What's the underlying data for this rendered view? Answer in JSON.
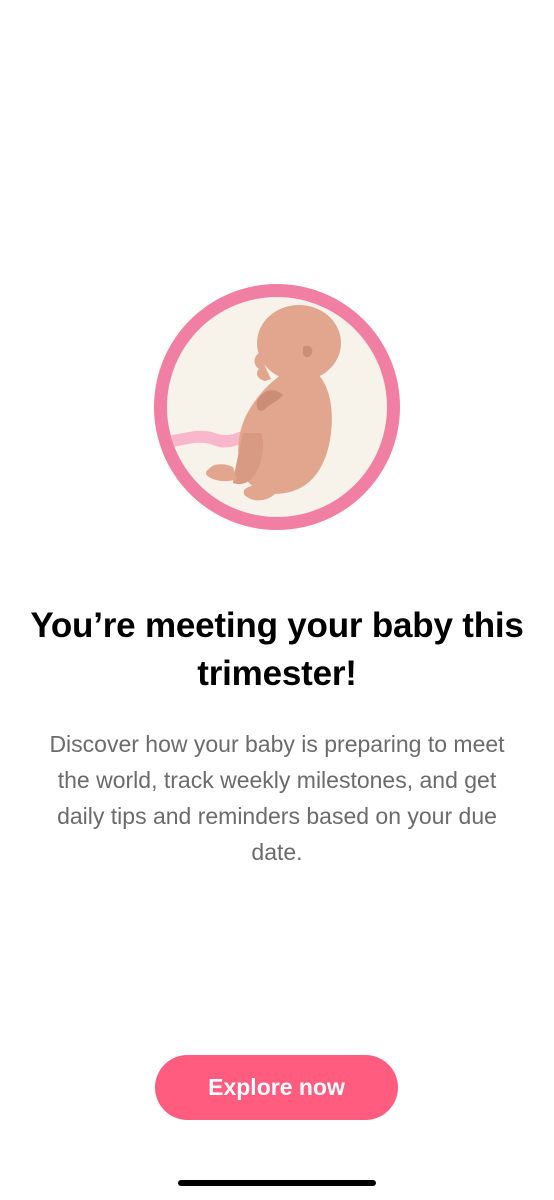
{
  "illustration": {
    "icon": "fetus-in-womb-illustration",
    "colors": {
      "ring": "#f07fa3",
      "inner": "#f7f3ea",
      "skin": "#e2a68e",
      "skin_shadow": "#cc8d76",
      "cord": "#f9b7cc"
    }
  },
  "content": {
    "headline": "You’re meeting your baby this trimester!",
    "description": "Discover how your baby is preparing to meet the world, track weekly milestones, and get daily tips and reminders based on your due date."
  },
  "actions": {
    "explore_label": "Explore now",
    "accent_color": "#ff5c7f"
  }
}
